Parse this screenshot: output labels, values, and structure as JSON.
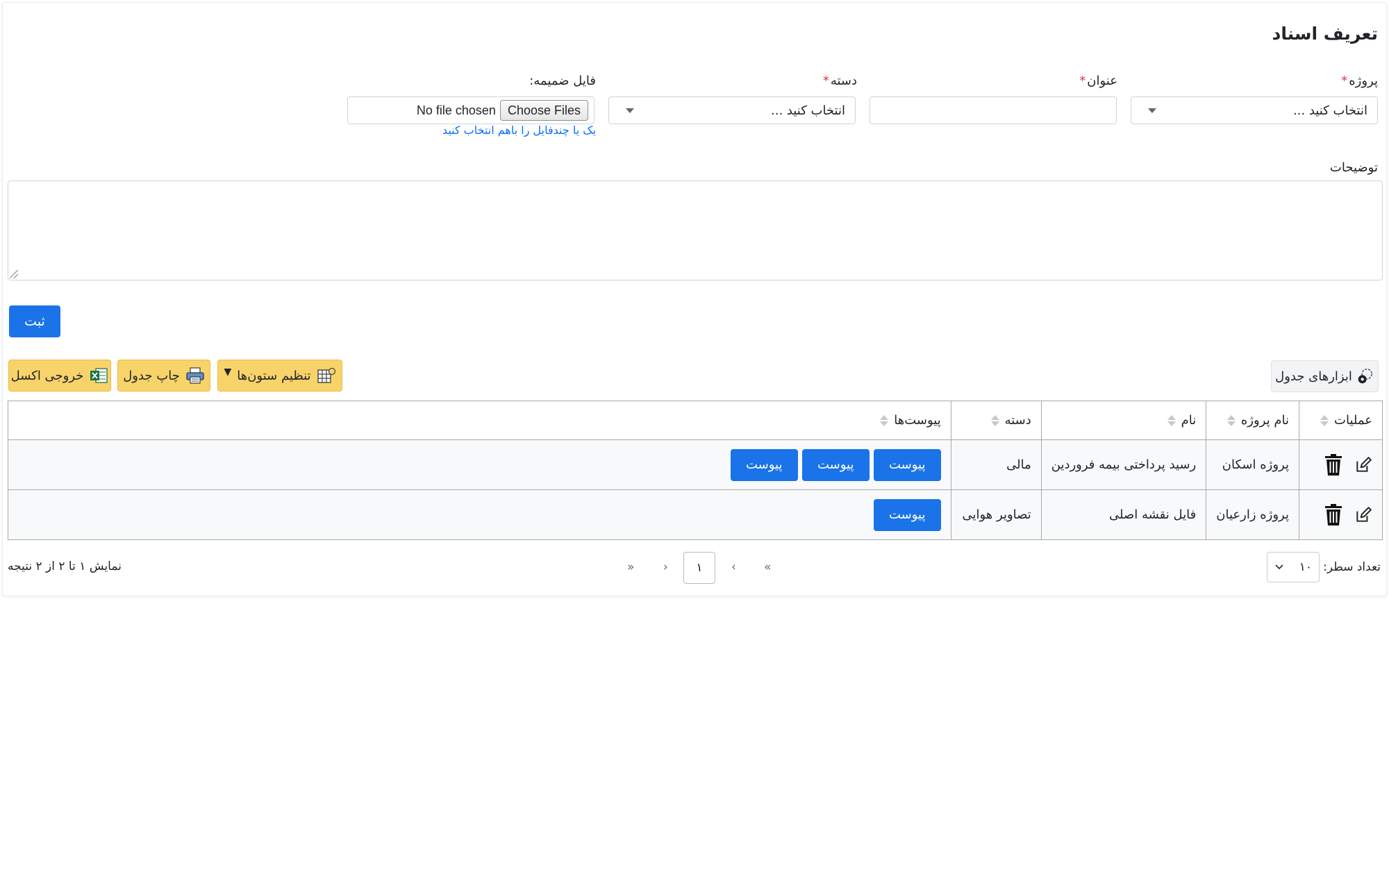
{
  "form": {
    "title": "تعریف اسناد",
    "project_label": "پروژه",
    "title_label": "عنوان",
    "category_label": "دسته",
    "attachment_label": "فایل ضمیمه:",
    "required_mark": "*",
    "select_placeholder": "انتخاب کنید ...",
    "file_button": "Choose Files",
    "file_status": "No file chosen",
    "file_hint": "یک یا چندفایل را باهم انتخاب کنید",
    "description_label": "توضیحات",
    "submit_label": "ثبت"
  },
  "toolbar": {
    "tools_label": "ابزارهای جدول",
    "columns_label": "تنظیم ستون‌ها",
    "print_label": "چاپ جدول",
    "excel_label": "خروجی اکسل"
  },
  "table": {
    "headers": [
      "عملیات",
      "نام پروژه",
      "نام",
      "دسته",
      "پیوست‌ها"
    ],
    "attachment_label": "پیوست",
    "rows": [
      {
        "project": "پروژه اسکان",
        "name": "رسید پرداختی بیمه فروردین",
        "category": "مالی",
        "attachments": 3
      },
      {
        "project": "پروژه زارعیان",
        "name": "فایل نقشه اصلی",
        "category": "تصاویر هوایی",
        "attachments": 1
      }
    ]
  },
  "pagination": {
    "rows_label": "تعداد سطر:",
    "rows_value": "۱۰",
    "current_page": "۱",
    "first": "«",
    "prev": "‹",
    "next": "›",
    "last": "»",
    "summary": "نمایش ۱ تا ۲ از ۲ نتیجه"
  },
  "colors": {
    "primary": "#1a73e8",
    "warning": "#f8d36a",
    "required": "#dc3545",
    "link": "#0d6efd"
  },
  "icons": [
    "trash-icon",
    "edit-icon",
    "gear-icon",
    "table-columns-icon",
    "printer-icon",
    "excel-icon",
    "chevron-down-icon"
  ]
}
